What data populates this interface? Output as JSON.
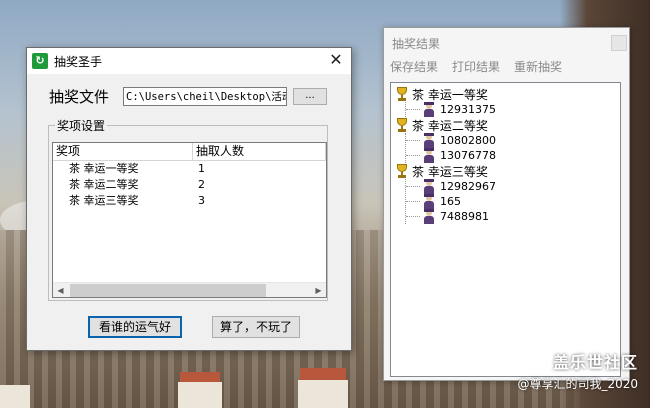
{
  "main_dialog": {
    "title": "抽奖圣手",
    "file_label": "抽奖文件",
    "file_path": "C:\\Users\\cheil\\Desktop\\活动抽",
    "browse_label": "...",
    "group_label": "奖项设置",
    "table": {
      "columns": [
        "奖项",
        "抽取人数"
      ],
      "rows": [
        {
          "prize": "茶 幸运一等奖",
          "count": "1"
        },
        {
          "prize": "茶 幸运二等奖",
          "count": "2"
        },
        {
          "prize": "茶 幸运三等奖",
          "count": "3"
        }
      ]
    },
    "draw_button": "看谁的运气好",
    "quit_button": "算了，不玩了"
  },
  "results_window": {
    "title": "抽奖结果",
    "menu": [
      "保存结果",
      "打印结果",
      "重新抽奖"
    ],
    "groups": [
      {
        "name": "茶 幸运一等奖",
        "winners": [
          "12931375"
        ]
      },
      {
        "name": "茶 幸运二等奖",
        "winners": [
          "10802800",
          "13076778"
        ]
      },
      {
        "name": "茶 幸运三等奖",
        "winners": [
          "12982967",
          "165",
          "7488981"
        ]
      }
    ]
  },
  "watermark": {
    "title": "盖乐世社区",
    "subtitle": "@尊享汇的司我_2020"
  },
  "icons": {
    "app": "app-logo-icon",
    "close": "close-icon",
    "prize": "trophy-icon",
    "winner": "person-icon"
  },
  "colors": {
    "default_button_border": "#0a64ad",
    "app_icon": "#1f9a3a",
    "trophy": "#e2b31f"
  }
}
